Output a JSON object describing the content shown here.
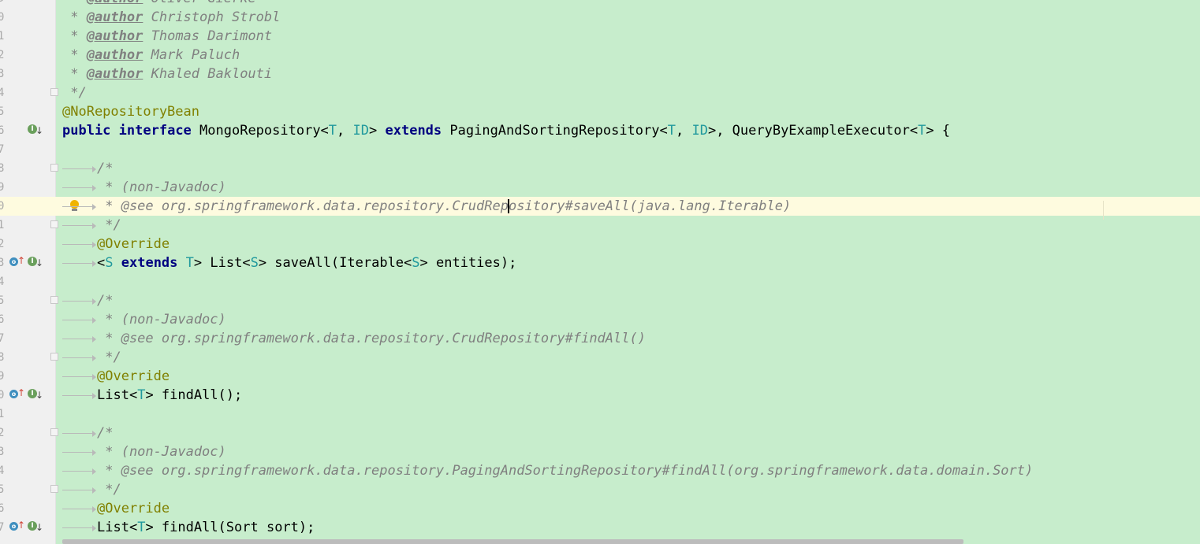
{
  "gutter": {
    "line_numbers": [
      "9",
      "0",
      "1",
      "2",
      "3",
      "4",
      "5",
      "6",
      "7",
      "8",
      "9",
      "0",
      "1",
      "2",
      "3",
      "4",
      "5",
      "6",
      "7",
      "8",
      "9",
      "0",
      "1",
      "2",
      "3",
      "4",
      "5",
      "6",
      "7"
    ]
  },
  "code": {
    "l0_a": " * ",
    "l0_tag": "@author",
    "l0_b": " Oliver Gierke",
    "l1_a": " * ",
    "l1_tag": "@author",
    "l1_b": " Christoph Strobl",
    "l2_a": " * ",
    "l2_tag": "@author",
    "l2_b": " Thomas Darimont",
    "l3_a": " * ",
    "l3_tag": "@author",
    "l3_b": " Mark Paluch",
    "l4_a": " * ",
    "l4_tag": "@author",
    "l4_b": " Khaled Baklouti",
    "l5": " */",
    "l6": "@NoRepositoryBean",
    "l7_public": "public",
    "l7_interface": "interface",
    "l7_name": " MongoRepository<",
    "l7_T": "T",
    "l7_sep": ", ",
    "l7_ID": "ID",
    "l7_close": "> ",
    "l7_extends": "extends",
    "l7_pas": " PagingAndSortingRepository<",
    "l7_T2": "T",
    "l7_sep2": ", ",
    "l7_ID2": "ID",
    "l7_qbe": ">, QueryByExampleExecutor<",
    "l7_T3": "T",
    "l7_end": "> {",
    "l9": "/*",
    "l10": " * (non-Javadoc)",
    "l11_a": " * @see org.springframework.data.repository.CrudRep",
    "l11_b": "ository#saveAll(java.lang.Iterable)",
    "l12": " */",
    "l13": "@Override",
    "l14_lt": "<",
    "l14_S": "S",
    "l14_sp": " ",
    "l14_extends": "extends",
    "l14_sp2": " ",
    "l14_T": "T",
    "l14_a": "> List<",
    "l14_S2": "S",
    "l14_b": "> saveAll(Iterable<",
    "l14_S3": "S",
    "l14_c": "> entities);",
    "l16": "/*",
    "l17": " * (non-Javadoc)",
    "l18": " * @see org.springframework.data.repository.CrudRepository#findAll()",
    "l19": " */",
    "l20": "@Override",
    "l21_a": "List<",
    "l21_T": "T",
    "l21_b": "> findAll();",
    "l23": "/*",
    "l24": " * (non-Javadoc)",
    "l25": " * @see org.springframework.data.repository.PagingAndSortingRepository#findAll(org.springframework.data.domain.Sort)",
    "l26": " */",
    "l27": "@Override",
    "l28_a": "List<",
    "l28_T": "T",
    "l28_b": "> findAll(Sort sort);"
  },
  "icons": {
    "implemented": "implemented-icon",
    "overrides": "overrides-icon",
    "intention_bulb": "lightbulb-icon"
  },
  "colors": {
    "background": "#c7edcc",
    "current_line": "#fefbdf",
    "keyword": "#000080",
    "annotation": "#808000",
    "type_param": "#20999d",
    "comment": "#808080"
  }
}
